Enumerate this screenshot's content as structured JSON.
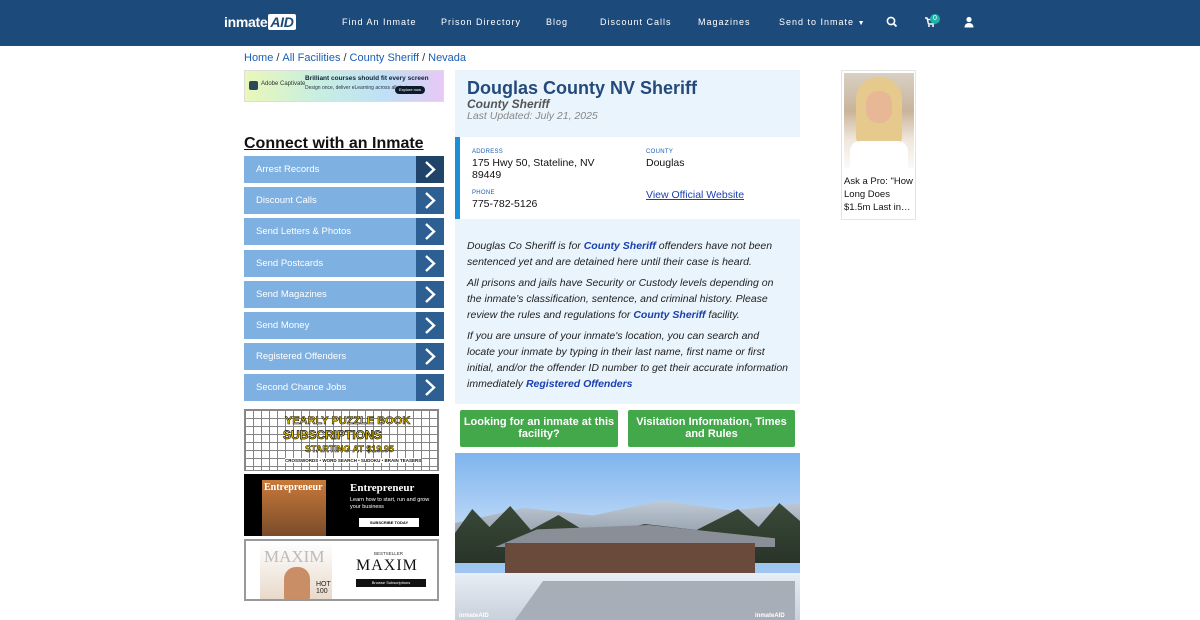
{
  "nav": {
    "logo_text": "inmate",
    "logo_aid": "AID",
    "items": [
      "Find An Inmate",
      "Prison Directory",
      "Blog",
      "Discount Calls",
      "Magazines",
      "Send to Inmate"
    ],
    "cart_count": "0"
  },
  "breadcrumb": [
    "Home",
    "All Facilities",
    "County Sheriff",
    "Nevada"
  ],
  "ad_top": {
    "brand": "Adobe Captivate",
    "headline": "Brilliant courses should fit every screen",
    "subline": "Design once, deliver eLearning across all devices",
    "button": "Explore now"
  },
  "connect": {
    "title": "Connect with an Inmate",
    "items": [
      "Arrest Records",
      "Discount Calls",
      "Send Letters & Photos",
      "Send Postcards",
      "Send Magazines",
      "Send Money",
      "Registered Offenders",
      "Second Chance Jobs"
    ]
  },
  "ad_puzzle": {
    "line1": "YEARLY PUZZLE BOOK",
    "line2": "SUBSCRIPTIONS",
    "line3": "STARTING AT $19.95",
    "line4": "CROSSWORDS • WORD SEARCH • SUDOKU • BRAIN TEASERS"
  },
  "ad_entrepreneur": {
    "cover_name": "Entrepreneur",
    "name": "Entrepreneur",
    "text": "Learn how to start, run and grow your business",
    "button": "SUBSCRIBE TODAY"
  },
  "ad_maxim": {
    "cover_name": "MAXIM",
    "hot": "HOT 100",
    "bestseller": "BESTSELLER",
    "name": "MAXIM",
    "button": "Browse Subscriptions"
  },
  "facility": {
    "title": "Douglas County NV Sheriff",
    "type": "County Sheriff",
    "last_updated": "Last Updated: July 21, 2025",
    "address_label": "ADDRESS",
    "address_line1": "175 Hwy 50, Stateline, NV",
    "address_line2": "89449",
    "county_label": "COUNTY",
    "county": "Douglas",
    "phone_label": "PHONE",
    "phone": "775-782-5126",
    "website_link": "View Official Website"
  },
  "description": {
    "p1_a": "Douglas Co Sheriff is for ",
    "p1_link": "County Sheriff",
    "p1_b": " offenders have not been sentenced yet and are detained here until their case is heard.",
    "p2_a": "All prisons and jails have Security or Custody levels depending on the inmate’s classification, sentence, and criminal history. Please review the rules and regulations for ",
    "p2_link": "County Sheriff",
    "p2_b": " facility.",
    "p3_a": "If you are unsure of your inmate's location, you can search and locate your inmate by typing in their last name, first name or first initial, and/or the offender ID number to get their accurate information immediately ",
    "p3_link": "Registered Offenders"
  },
  "buttons": {
    "looking": "Looking for an inmate at this facility?",
    "visitation": "Visitation Information, Times and Rules"
  },
  "photo": {
    "watermark_left": "inmateAID",
    "watermark_right": "inmateAID"
  },
  "right_ad": {
    "caption": "Ask a Pro: \"How Long Does $1.5m Last in…"
  },
  "colors": {
    "nav_bg": "#1c4a7b",
    "menu_item": "#7fb0e2",
    "menu_arrow": "#2d5f92",
    "green_button": "#43a84a",
    "info_bg": "#eaf4fc",
    "accent_border": "#1a8fd8"
  }
}
